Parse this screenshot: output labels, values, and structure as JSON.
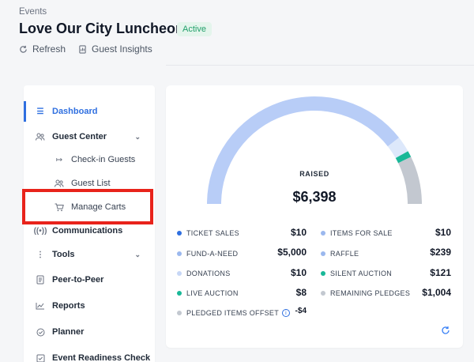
{
  "header": {
    "breadcrumb": "Events",
    "title": "Love Our City Luncheon",
    "status": "Active",
    "actions": {
      "refresh": "Refresh",
      "guest_insights": "Guest Insights"
    }
  },
  "sidebar": {
    "items": [
      {
        "label": "Dashboard"
      },
      {
        "label": "Guest Center"
      },
      {
        "label": "Check-in Guests"
      },
      {
        "label": "Guest List"
      },
      {
        "label": "Manage Carts"
      },
      {
        "label": "Communications"
      },
      {
        "label": "Tools"
      },
      {
        "label": "Peer-to-Peer"
      },
      {
        "label": "Reports"
      },
      {
        "label": "Planner"
      },
      {
        "label": "Event Readiness Check"
      }
    ]
  },
  "summary": {
    "raised_label": "RAISED",
    "raised_value": "$6,398",
    "gauge_fractions": {
      "main": 0.82,
      "light": 0.05,
      "teal": 0.02,
      "gray": 0.15
    },
    "colors": {
      "main": "#b8cdf7",
      "light": "#dde8fb",
      "teal": "#19b898",
      "gray": "#c3c8d0"
    },
    "left": [
      {
        "label": "TICKET SALES",
        "value": "$10",
        "color": "#2f6fe0"
      },
      {
        "label": "FUND-A-NEED",
        "value": "$5,000",
        "color": "#9bb8ee"
      },
      {
        "label": "DONATIONS",
        "value": "$10",
        "color": "#c7d7f6"
      },
      {
        "label": "LIVE AUCTION",
        "value": "$8",
        "color": "#19b898"
      },
      {
        "label": "PLEDGED ITEMS OFFSET",
        "value": "-$4",
        "color": "#c3c8d0"
      }
    ],
    "right": [
      {
        "label": "ITEMS FOR SALE",
        "value": "$10",
        "color": "#9bb8ee"
      },
      {
        "label": "RAFFLE",
        "value": "$239",
        "color": "#9bb8ee"
      },
      {
        "label": "SILENT AUCTION",
        "value": "$121",
        "color": "#19b898"
      },
      {
        "label": "REMAINING PLEDGES",
        "value": "$1,004",
        "color": "#c3c8d0"
      }
    ]
  }
}
